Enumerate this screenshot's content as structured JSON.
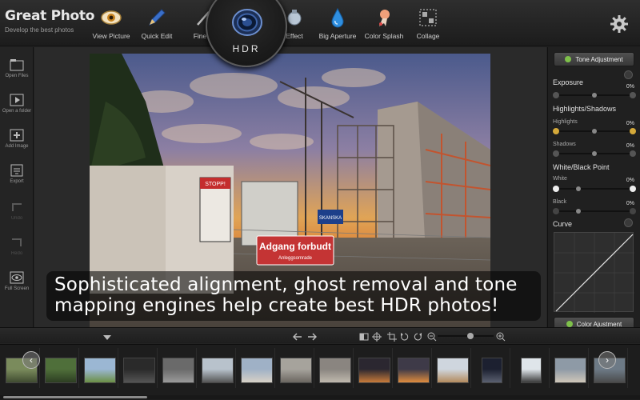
{
  "app": {
    "title": "Great Photo",
    "subtitle": "Develop the best photos"
  },
  "toolbar": {
    "tools": [
      {
        "label": "View Picture",
        "icon": "eye-icon"
      },
      {
        "label": "Quick Edit",
        "icon": "pencil-icon"
      },
      {
        "label": "Fine E",
        "icon": "brush-icon"
      },
      {
        "label": "Effect",
        "icon": "potion-icon"
      },
      {
        "label": "Big Aperture",
        "icon": "water-drop-icon"
      },
      {
        "label": "Color Splash",
        "icon": "color-splash-icon"
      },
      {
        "label": "Collage",
        "icon": "collage-icon"
      }
    ],
    "active_tool": {
      "label": "HDR",
      "icon": "camera-lens-icon"
    },
    "settings_icon": "gear-icon"
  },
  "sidebar": {
    "items": [
      {
        "label": "Open Files",
        "icon": "folder-icon",
        "enabled": true
      },
      {
        "label": "Open a folder",
        "icon": "play-folder-icon",
        "enabled": true
      },
      {
        "label": "Add Image",
        "icon": "add-image-icon",
        "enabled": true
      },
      {
        "label": "Export",
        "icon": "export-icon",
        "enabled": true
      },
      {
        "label": "Undo",
        "icon": "undo-icon",
        "enabled": false
      },
      {
        "label": "Redo",
        "icon": "redo-icon",
        "enabled": false
      },
      {
        "label": "Full Screen",
        "icon": "eye-icon",
        "enabled": true
      }
    ]
  },
  "photo": {
    "caption": "Sophisticated alignment, ghost removal and tone mapping engines help create best HDR photos!",
    "signs": {
      "sign1": "Adgang forbudt",
      "sign1_sub": "Anleggsomrade",
      "sign2": "STOPP!",
      "sign3": "SKANSKA"
    }
  },
  "panel": {
    "tone_button": "Tone Adjustment",
    "color_button": "Color Ajustment",
    "exposure": {
      "label": "Exposure",
      "value": "0%",
      "level": 0.5
    },
    "highlights_shadows": {
      "label": "Highlights/Shadows",
      "highlights": {
        "label": "Highlights",
        "value": "0%",
        "level": 0.5
      },
      "shadows": {
        "label": "Shadows",
        "value": "0%",
        "level": 0.5
      }
    },
    "white_black": {
      "label": "White/Black Point",
      "white": {
        "label": "White",
        "value": "0%",
        "level": 0.25
      },
      "black": {
        "label": "Black",
        "value": "0%",
        "level": 0.25
      }
    },
    "curve": {
      "label": "Curve"
    }
  },
  "controls": {
    "icons": [
      "dropdown-arrow-icon",
      "arrow-left-icon",
      "arrow-right-icon",
      "compare-icon",
      "move-icon",
      "crop-icon",
      "rotate-ccw-icon",
      "rotate-cw-icon",
      "zoom-out-icon",
      "zoom-in-icon"
    ],
    "zoom_level": 0.6
  },
  "filmstrip": {
    "thumb_count": 16,
    "scroll_position": 0
  },
  "colors": {
    "accent_green": "#7ec04a",
    "highlight_gold": "#d4a93a",
    "panel_bg": "#202020"
  }
}
